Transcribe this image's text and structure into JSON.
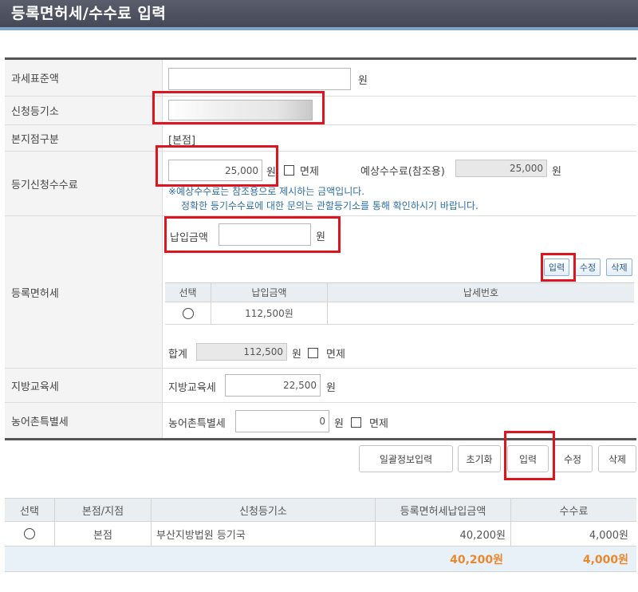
{
  "page_title": "등록면허세/수수료 입력",
  "form": {
    "tax_base": {
      "label": "과세표준액",
      "value": "",
      "unit": "원"
    },
    "registry": {
      "label": "신청등기소",
      "value": ""
    },
    "branch_type": {
      "label": "본지점구분",
      "value": "[본점]"
    },
    "registration_fee": {
      "label": "등기신청수수료",
      "value": "25,000",
      "unit": "원",
      "exempt_label": "면제",
      "expected_label": "예상수수료(참조용)",
      "expected_value": "25,000",
      "expected_unit": "원",
      "note_line1": "※예상수수료는 참조용으로 제시하는 금액입니다.",
      "note_line2": "정확한 등기수수료에 대한 문의는 관할등기소를 통해 확인하시기 바랍니다."
    },
    "registration_license_tax": {
      "label": "등록면허세",
      "payment_label": "납입금액",
      "payment_value": "",
      "payment_unit": "원",
      "buttons": {
        "input": "입력",
        "edit": "수정",
        "delete": "삭제"
      },
      "table": {
        "headers": [
          "선택",
          "납입금액",
          "납세번호"
        ],
        "rows": [
          {
            "amount": "112,500원",
            "tax_no": ""
          }
        ]
      },
      "total_label": "합계",
      "total_value": "112,500",
      "total_unit": "원",
      "exempt_label": "면제"
    },
    "local_education_tax": {
      "label": "지방교육세",
      "field_label": "지방교육세",
      "value": "22,500",
      "unit": "원"
    },
    "rural_special_tax": {
      "label": "농어촌특별세",
      "field_label": "농어촌특별세",
      "value": "0",
      "unit": "원",
      "exempt_label": "면제"
    }
  },
  "actions": {
    "bulk_input": "일괄정보입력",
    "reset": "초기화",
    "input": "입력",
    "edit": "수정",
    "delete": "삭제"
  },
  "list": {
    "headers": [
      "선택",
      "본점/지점",
      "신청등기소",
      "등록면허세납입금액",
      "수수료"
    ],
    "rows": [
      {
        "branch": "본점",
        "registry": "부산지방법원 등기국",
        "tax_amount": "40,200원",
        "fee": "4,000원"
      }
    ],
    "total_tax": "40,200원",
    "total_fee": "4,000원"
  },
  "colors": {
    "highlight": "#e0141e",
    "total_accent": "#e8892f",
    "header_bg": "#4f5260"
  }
}
